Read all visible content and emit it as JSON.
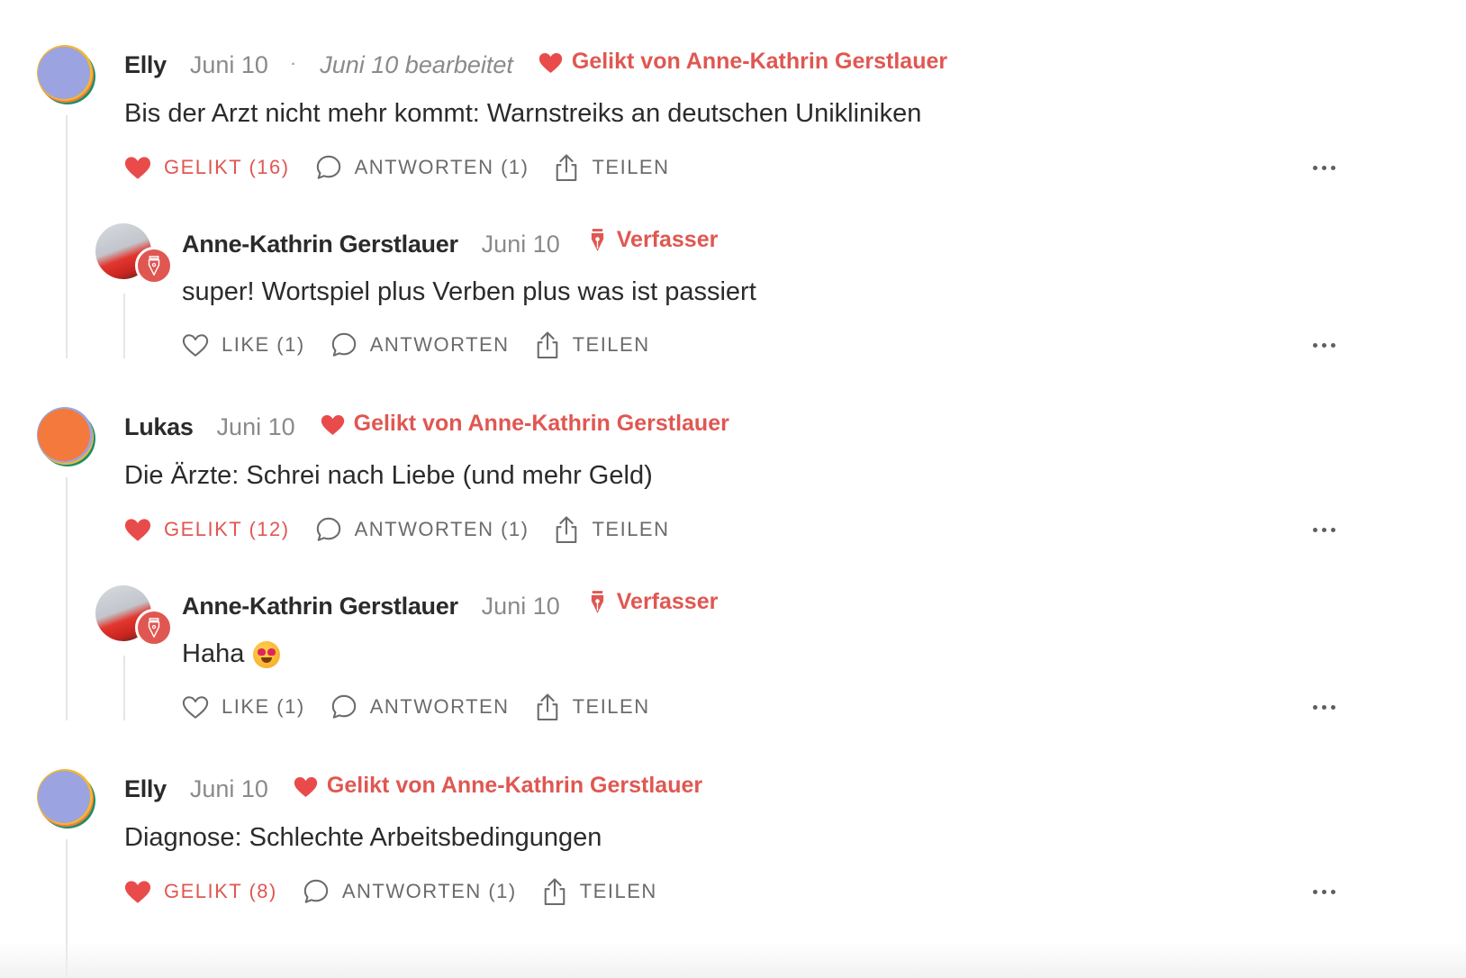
{
  "threads": [
    {
      "author": "Elly",
      "date": "Juni 10",
      "edited_sep": "·",
      "edited": "Juni 10 bearbeitet",
      "liked_by": "Gelikt von Anne-Kathrin Gerstlauer",
      "text": "Bis der Arzt nicht mehr kommt: Warnstreiks an deutschen Unikliniken",
      "like_label": "GELIKT (16)",
      "reply_label": "ANTWORTEN (1)",
      "share_label": "TEILEN",
      "reply": {
        "author": "Anne-Kathrin Gerstlauer",
        "date": "Juni 10",
        "badge": "Verfasser",
        "text": "super! Wortspiel plus Verben plus was ist passiert",
        "like_label": "LIKE (1)",
        "reply_label": "ANTWORTEN",
        "share_label": "TEILEN"
      }
    },
    {
      "author": "Lukas",
      "date": "Juni 10",
      "liked_by": "Gelikt von Anne-Kathrin Gerstlauer",
      "text": "Die Ärzte: Schrei nach Liebe (und mehr Geld)",
      "like_label": "GELIKT (12)",
      "reply_label": "ANTWORTEN (1)",
      "share_label": "TEILEN",
      "reply": {
        "author": "Anne-Kathrin Gerstlauer",
        "date": "Juni 10",
        "badge": "Verfasser",
        "text": "Haha",
        "emoji": "heart-eyes-emoji",
        "like_label": "LIKE (1)",
        "reply_label": "ANTWORTEN",
        "share_label": "TEILEN"
      }
    },
    {
      "author": "Elly",
      "date": "Juni 10",
      "liked_by": "Gelikt von Anne-Kathrin Gerstlauer",
      "text": "Diagnose: Schlechte Arbeitsbedingungen",
      "like_label": "GELIKT (8)",
      "reply_label": "ANTWORTEN (1)",
      "share_label": "TEILEN"
    }
  ],
  "colors": {
    "accent": "#e05752",
    "text": "#2b2b2b",
    "muted": "#8a8a8a",
    "action": "#6b6b6b",
    "thread_line": "#e6e6e6"
  },
  "icons": [
    "heart-icon",
    "comment-icon",
    "share-icon",
    "more-icon",
    "pen-nib-icon"
  ]
}
